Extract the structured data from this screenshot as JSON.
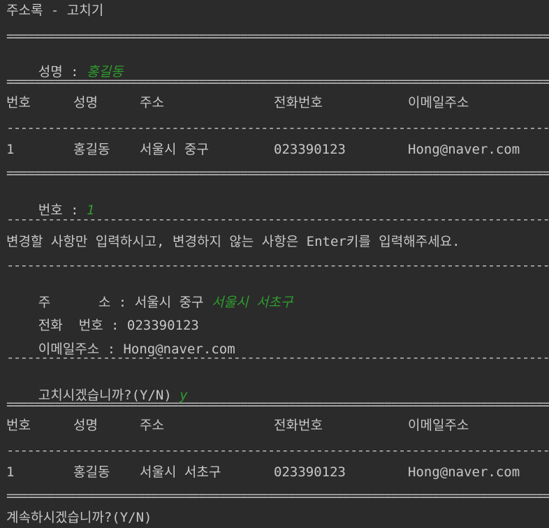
{
  "title": "주소록 - 고치기",
  "rules": {
    "double": "======================================================================================================",
    "single": "------------------------------------------------------------------------------------------------------"
  },
  "name_prompt": {
    "label": "성명 : ",
    "input": "홍길동"
  },
  "table_headers": {
    "no": "번호",
    "name": "성명",
    "address": "주소",
    "phone": "전화번호",
    "email": "이메일주소"
  },
  "result_before": {
    "no": "1",
    "name": "홍길동",
    "address": "서울시 중구",
    "phone": "023390123",
    "email": "Hong@naver.com"
  },
  "number_prompt": {
    "label": "번호 : ",
    "input": "1"
  },
  "instruction": "변경할 사항만 입력하시고, 변경하지 않는 사항은 Enter키를 입력해주세요.",
  "edit_fields": {
    "address_label": "주      소 : ",
    "address_current": "서울시 중구",
    "address_input": "서울시 서초구",
    "phone_label": "전화  번호 : ",
    "phone_current": "023390123",
    "email_label": "이메일주소 : ",
    "email_current": "Hong@naver.com"
  },
  "confirm_prompt": {
    "label": "고치시겠습니까?(Y/N) ",
    "input": "y"
  },
  "result_after": {
    "no": "1",
    "name": "홍길동",
    "address": "서울시 서초구",
    "phone": "023390123",
    "email": "Hong@naver.com"
  },
  "continue_prompt": "계속하시겠습니까?(Y/N)",
  "colors": {
    "background": "#2b2b2b",
    "text": "#c7c7c7",
    "user_input": "#2f9d2f"
  }
}
